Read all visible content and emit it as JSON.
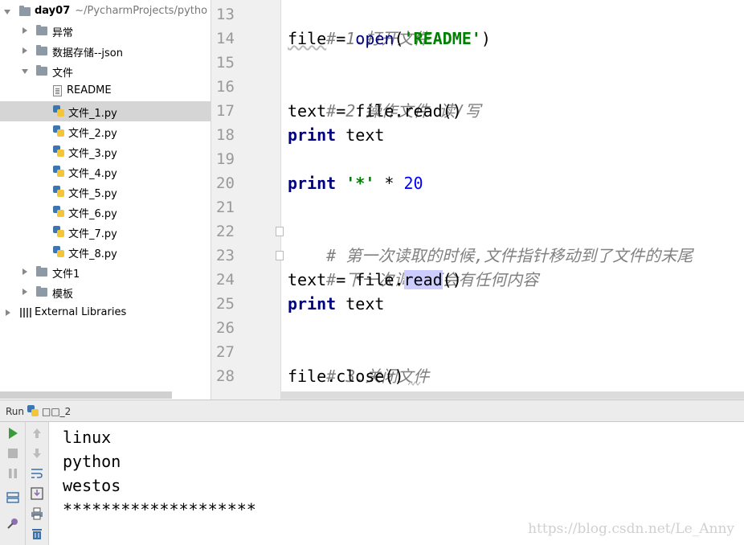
{
  "project_tree": {
    "root": {
      "name": "day07",
      "path": "~/PycharmProjects/pytho"
    },
    "items": [
      {
        "label": "异常",
        "kind": "folder",
        "expanded": false
      },
      {
        "label": "数据存储--json",
        "kind": "folder",
        "expanded": false
      },
      {
        "label": "文件",
        "kind": "folder",
        "expanded": true
      },
      {
        "label": "README",
        "kind": "text"
      },
      {
        "label": "文件_1.py",
        "kind": "python",
        "selected": true
      },
      {
        "label": "文件_2.py",
        "kind": "python"
      },
      {
        "label": "文件_3.py",
        "kind": "python"
      },
      {
        "label": "文件_4.py",
        "kind": "python"
      },
      {
        "label": "文件_5.py",
        "kind": "python"
      },
      {
        "label": "文件_6.py",
        "kind": "python"
      },
      {
        "label": "文件_7.py",
        "kind": "python"
      },
      {
        "label": "文件_8.py",
        "kind": "python"
      },
      {
        "label": "文件1",
        "kind": "folder",
        "expanded": false
      },
      {
        "label": "模板",
        "kind": "folder",
        "expanded": false
      },
      {
        "label": "External Libraries",
        "kind": "library",
        "expanded": false
      }
    ]
  },
  "editor": {
    "line_numbers": [
      "13",
      "14",
      "15",
      "16",
      "17",
      "18",
      "19",
      "20",
      "21",
      "22",
      "23",
      "24",
      "25",
      "26",
      "27",
      "28"
    ],
    "lines": {
      "l13": {
        "comment": "# 1.打开文件"
      },
      "l14": {
        "var": "file",
        "eq": " = ",
        "fn": "open",
        "open": "(",
        "str": "'README'",
        "close": ")"
      },
      "l16": {
        "comment": "# 2.操作文件 读/写"
      },
      "l17": {
        "text": "text = file.read()"
      },
      "l18": {
        "kw": "print",
        "rest": " text"
      },
      "l20": {
        "kw": "print",
        "sp": " ",
        "str": "'*'",
        "op": " * ",
        "num": "20"
      },
      "l22": {
        "comment": "# 第一次读取的时候,文件指针移动到了文件的末尾"
      },
      "l23": {
        "comment": "# 下一次调用不会有任何内容"
      },
      "l24": {
        "pre": "text = file.",
        "hl": "read",
        "post": "()"
      },
      "l25": {
        "kw": "print",
        "rest": " text"
      },
      "l27": {
        "comment": "# 3.关闭文件"
      },
      "l28": {
        "text": "file.close()"
      }
    }
  },
  "run_panel": {
    "title": "Run",
    "config": "□□_2",
    "output": [
      "linux",
      "python",
      "westos",
      "********************"
    ]
  },
  "watermark": "https://blog.csdn.net/Le_Anny",
  "colors": {
    "keyword": "#000080",
    "string": "#008000",
    "number": "#0000ff",
    "comment": "#808080",
    "selection": "#d5d5d5",
    "usage_highlight": "#ccccff",
    "run_green": "#3a9b3a"
  }
}
